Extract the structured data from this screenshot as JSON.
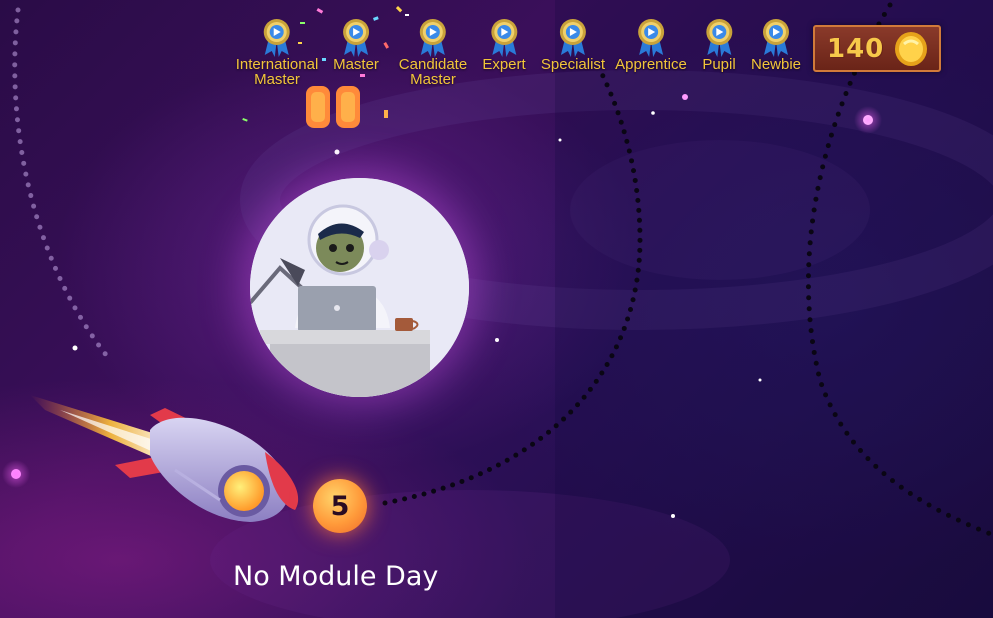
{
  "badges": [
    {
      "label": "International\nMaster"
    },
    {
      "label": "Master"
    },
    {
      "label": "Candidate\nMaster"
    },
    {
      "label": "Expert"
    },
    {
      "label": "Specialist"
    },
    {
      "label": "Apprentice"
    },
    {
      "label": "Pupil"
    },
    {
      "label": "Newbie"
    }
  ],
  "coins": {
    "count": "140",
    "icon": "gold-coin-icon"
  },
  "day": {
    "number": "5",
    "label": "No Module Day"
  },
  "colors": {
    "badge_label": "#f2c53a",
    "coin_box": "#7a2e20",
    "coin_text": "#f7c94a",
    "day_circle": "#ff9a3a",
    "background": "#2a0c47"
  },
  "icons": [
    "medal-ribbon-icon",
    "gold-coin-icon",
    "rocket-icon",
    "astronaut-avatar-icon"
  ]
}
